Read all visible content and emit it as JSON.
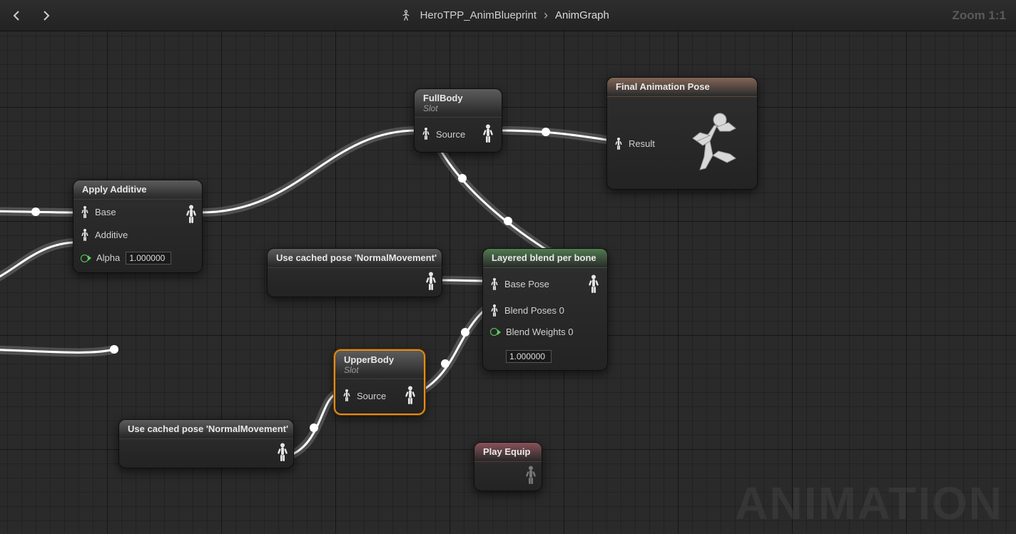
{
  "topbar": {
    "breadcrumb": {
      "asset": "HeroTPP_AnimBlueprint",
      "current": "AnimGraph"
    },
    "zoom_label": "Zoom 1:1"
  },
  "watermark": "ANIMATION",
  "nodes": {
    "apply_additive": {
      "title": "Apply Additive",
      "pins": {
        "base": "Base",
        "additive": "Additive",
        "alpha": "Alpha",
        "alpha_value": "1.000000"
      }
    },
    "fullbody": {
      "title": "FullBody",
      "subtitle": "Slot",
      "pin_source": "Source"
    },
    "final_pose": {
      "title": "Final Animation Pose",
      "pin_result": "Result"
    },
    "cached_pose_1": {
      "title": "Use cached pose 'NormalMovement'"
    },
    "cached_pose_2": {
      "title": "Use cached pose 'NormalMovement'"
    },
    "layered_blend": {
      "title": "Layered blend per bone",
      "pins": {
        "base_pose": "Base Pose",
        "blend_poses": "Blend Poses 0",
        "blend_weights": "Blend Weights 0",
        "blend_weights_value": "1.000000"
      }
    },
    "upperbody": {
      "title": "UpperBody",
      "subtitle": "Slot",
      "pin_source": "Source"
    },
    "play_equip": {
      "title": "Play Equip"
    }
  }
}
